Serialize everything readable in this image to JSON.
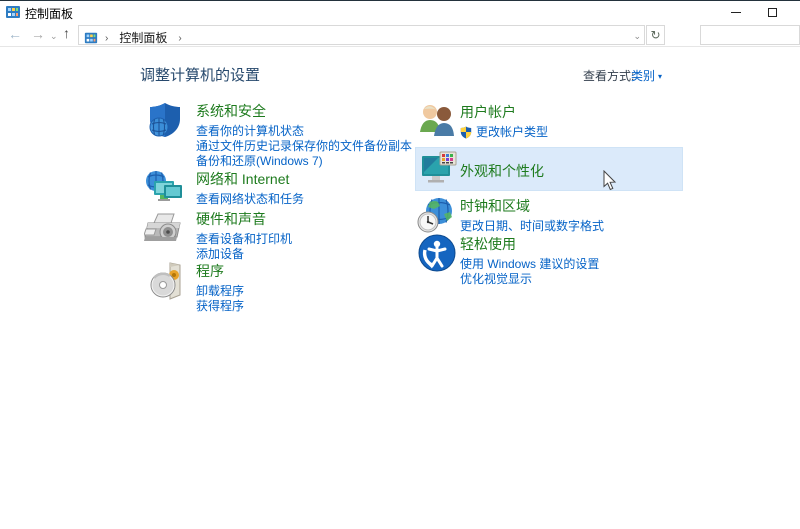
{
  "window": {
    "title": "控制面板",
    "minimize": "minimize",
    "maximize": "maximize"
  },
  "toolbar": {
    "back_glyph": "←",
    "forward_glyph": "→",
    "history_glyph": "⌄",
    "up_glyph": "↑",
    "refresh_glyph": "↻",
    "address_dropdown_glyph": "⌄",
    "breadcrumb": {
      "sep1": "›",
      "root": "控制面板",
      "sep2": "›"
    },
    "search": {
      "value": "",
      "placeholder": ""
    }
  },
  "page": {
    "title": "调整计算机的设置",
    "view_by_label": "查看方式:",
    "view_by_value": "类别",
    "view_by_arrow": "▼"
  },
  "categories": {
    "left": [
      {
        "icon": "security-shield-icon",
        "title": "系统和安全",
        "links": [
          "查看你的计算机状态",
          "通过文件历史记录保存你的文件备份副本",
          "备份和还原(Windows 7)"
        ]
      },
      {
        "icon": "network-globe-icon",
        "title": "网络和 Internet",
        "links": [
          "查看网络状态和任务"
        ]
      },
      {
        "icon": "printer-icon",
        "title": "硬件和声音",
        "links": [
          "查看设备和打印机",
          "添加设备"
        ]
      },
      {
        "icon": "program-disc-icon",
        "title": "程序",
        "links": [
          "卸载程序",
          "获得程序"
        ]
      }
    ],
    "right": [
      {
        "icon": "user-accounts-icon",
        "title": "用户帐户",
        "links": [
          "更改帐户类型"
        ]
      },
      {
        "icon": "appearance-monitor-icon",
        "title": "外观和个性化",
        "highlighted": true,
        "links": []
      },
      {
        "icon": "clock-globe-icon",
        "title": "时钟和区域",
        "links": [
          "更改日期、时间或数字格式"
        ]
      },
      {
        "icon": "ease-of-access-icon",
        "title": "轻松使用",
        "links": [
          "使用 Windows 建议的设置",
          "优化视觉显示"
        ]
      }
    ]
  },
  "colors": {
    "heading_green": "#1e7b1e",
    "link_blue": "#0663c7",
    "title_blue": "#27496d",
    "highlight_bg": "#dbeafa"
  }
}
